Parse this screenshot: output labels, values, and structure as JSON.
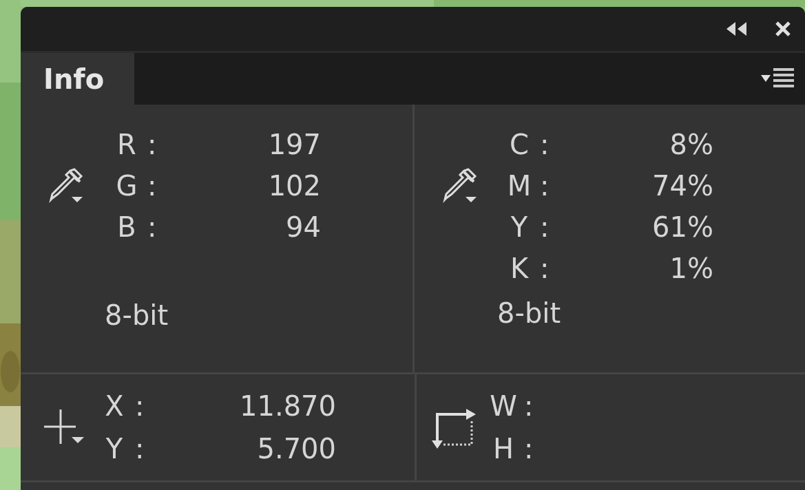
{
  "panel": {
    "tab": {
      "label": "Info",
      "selected": true
    },
    "color_readouts": [
      {
        "kind": "eyedropper",
        "rows": [
          {
            "label": "R",
            "sep": ":",
            "value": "197"
          },
          {
            "label": "G",
            "sep": ":",
            "value": "102"
          },
          {
            "label": "B",
            "sep": ":",
            "value": "94"
          }
        ],
        "bit_depth": "8-bit"
      },
      {
        "kind": "eyedropper",
        "rows": [
          {
            "label": "C",
            "sep": ":",
            "value": "8%"
          },
          {
            "label": "M",
            "sep": ":",
            "value": "74%"
          },
          {
            "label": "Y",
            "sep": ":",
            "value": "61%"
          },
          {
            "label": "K",
            "sep": ":",
            "value": "1%"
          }
        ],
        "bit_depth": "8-bit"
      }
    ],
    "geometry_readouts": [
      {
        "kind": "position",
        "rows": [
          {
            "label": "X",
            "sep": ":",
            "value": "11.870"
          },
          {
            "label": "Y",
            "sep": ":",
            "value": "5.700"
          }
        ]
      },
      {
        "kind": "size",
        "rows": [
          {
            "label": "W",
            "sep": ":"
          },
          {
            "label": "H",
            "sep": ":"
          }
        ]
      }
    ]
  }
}
